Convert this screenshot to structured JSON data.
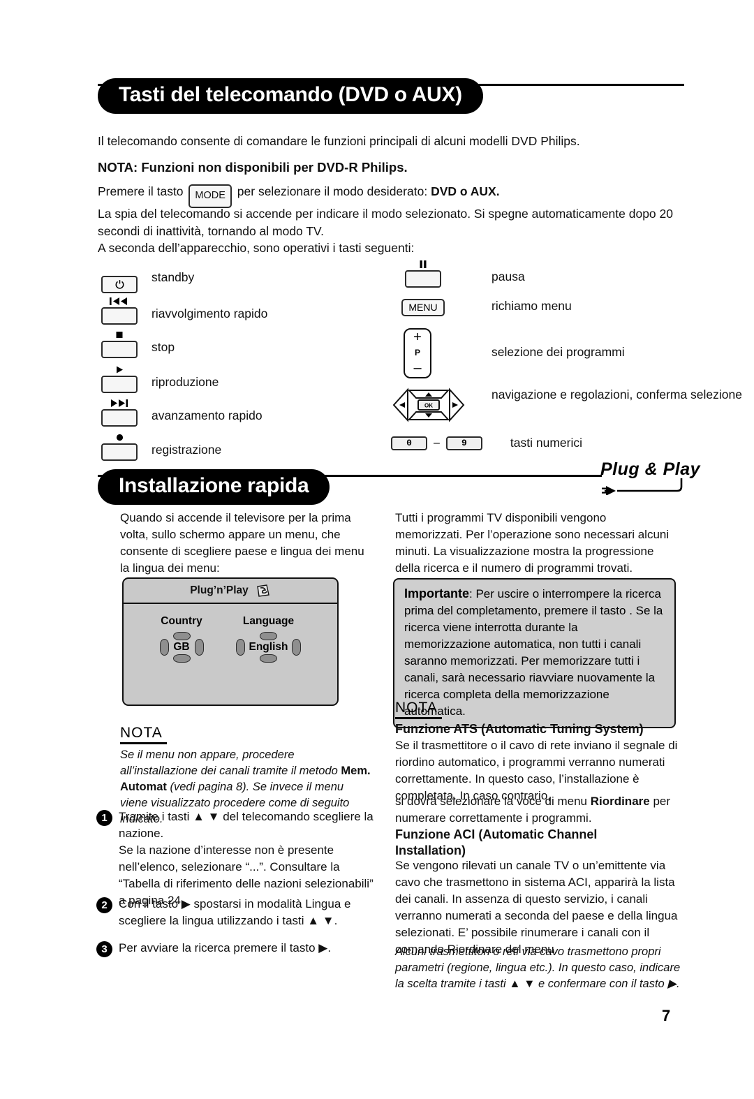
{
  "page": {
    "number": "7"
  },
  "section1": {
    "title": "Tasti del telecomando (DVD o AUX)",
    "intro": "Il telecomando consente di comandare le funzioni principali di alcuni modelli DVD Philips.",
    "note_bold": "NOTA: Funzioni non disponibili per DVD-R Philips.",
    "mode_line_pre": "Premere il tasto",
    "mode_key_label": "MODE",
    "mode_line_mid": "per selezionare il modo desiderato:",
    "mode_line_bold": "DVD o AUX.",
    "para_led": "La spia del telecomando si accende per indicare il modo selezionato. Si spegne automaticamente dopo 20 secondi di inattività, tornando al modo TV.",
    "para_keys": "A seconda dell’apparecchio, sono operativi i tasti seguenti:",
    "keys_left": [
      {
        "icon": "power-icon",
        "glyph": "⏻",
        "label": "standby"
      },
      {
        "icon": "rewind-icon",
        "glyph": "⏮◀",
        "label": "riavvolgimento rapido"
      },
      {
        "icon": "stop-icon",
        "glyph": "■",
        "label": "stop"
      },
      {
        "icon": "play-icon",
        "glyph": "▶",
        "label": "riproduzione"
      },
      {
        "icon": "fast-forward-icon",
        "glyph": "▶▶⏭",
        "label": "avanzamento rapido"
      },
      {
        "icon": "record-icon",
        "glyph": "●",
        "label": "registrazione"
      }
    ],
    "keys_right": [
      {
        "icon": "pause-icon",
        "glyph": "▐▐",
        "label": "pausa"
      },
      {
        "icon": "menu-key",
        "text": "MENU",
        "label": "richiamo menu"
      },
      {
        "icon": "program-key",
        "plus": "+",
        "p": "P",
        "minus": "–",
        "label": "selezione dei programmi"
      },
      {
        "icon": "nav-pad-icon",
        "ok": "OK",
        "label": "navigazione e regolazioni, conferma selezione"
      },
      {
        "icon": "numeric-keys",
        "from": "0",
        "dash": "–",
        "to": "9",
        "label": "tasti numerici"
      }
    ]
  },
  "section2": {
    "title": "Installazione rapida",
    "logo_text": "Plug & Play",
    "left": {
      "intro": "Quando si accende il televisore per la prima volta, sullo schermo appare un menu, che consente di scegliere paese e lingua dei menu la lingua dei menu:",
      "screen": {
        "title": "Plug’n’Play",
        "country_label": "Country",
        "country_value": "GB",
        "language_label": "Language",
        "language_value": "English"
      },
      "nota_heading": "NOTA",
      "nota_part1": "Se il menu non appare, procedere all’installazione dei canali tramite il metodo ",
      "nota_bold": "Mem. Automat",
      "nota_part2": " (vedi pagina 8). Se invece il menu viene visualizzato procedere come di seguito indicato.",
      "steps": [
        {
          "n": "1",
          "text": "Tramite i tasti ▲ ▼ del telecomando scegliere la nazione.\nSe la nazione d’interesse non è presente nell’elenco, selezionare “...”. Consultare la “Tabella di riferimento delle nazioni selezionabili” a pagina 24."
        },
        {
          "n": "2",
          "text": "Con il tasto ▶ spostarsi in modalità Lingua e scegliere la lingua utilizzando i tasti ▲ ▼."
        },
        {
          "n": "3",
          "text": "Per avviare la ricerca premere il tasto ▶."
        }
      ]
    },
    "right": {
      "intro": "Tutti i programmi TV disponibili vengono memorizzati. Per l’operazione sono necessari alcuni minuti. La visualizzazione mostra la progressione della ricerca e il numero di programmi trovati.",
      "importante_label": "Importante",
      "importante_text": ": Per uscire o interrompere la ricerca prima del completamento, premere il tasto . Se la ricerca viene interrotta durante la memorizzazione automatica, non tutti i canali saranno memorizzati. Per memorizzare tutti i canali, sarà necessario riavviare nuovamente la ricerca completa della memorizzazione automatica.",
      "nota_heading": "NOTA",
      "ats_heading": "Funzione ATS (Automatic Tuning System)",
      "ats_text_a": "Se il trasmettitore o il cavo di rete inviano il segnale di riordino automatico, i programmi verranno numerati correttamente. In questo caso, l’installazione è completata. In caso contrario,",
      "ats_text_b_pre": "si dovrà selezionare la voce di menu ",
      "ats_text_b_bold": "Riordinare",
      "ats_text_b_post": " per numerare correttamente i programmi.",
      "aci_heading": "Funzione ACI (Automatic Channel Installation)",
      "aci_text": "Se vengono rilevati un canale TV o un’emittente via cavo che trasmettono in sistema ACI, apparirà la lista dei canali. In assenza di questo servizio, i canali verranno numerati a seconda del paese e della lingua selezionati. E’ possibile rinumerare i canali con il comando Riordinare del menu.",
      "italic_note": "Alcuni trasmettitori o reti via cavo trasmettono propri parametri (regione, lingua etc.). In questo caso, indicare la scelta tramite i tasti ▲ ▼ e confermare con il tasto ▶."
    }
  }
}
